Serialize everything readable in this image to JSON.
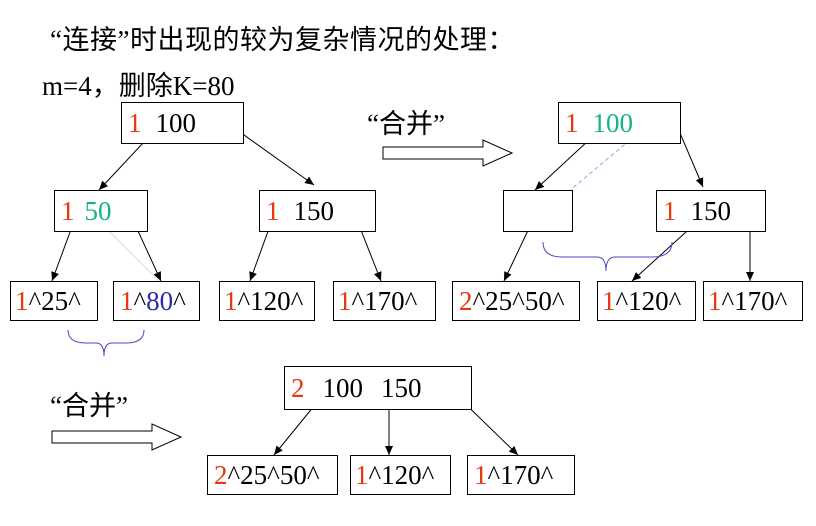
{
  "heading": "“连接”时出现的较为复杂情况的处理：",
  "condition": "m=4，删除K=80",
  "merge_label": "“合并”",
  "colors": {
    "count": "#e8380d",
    "highlight_key": "#15b38a",
    "deleted_key": "#2a2ab0",
    "brace": "#4a4ac0"
  },
  "tree1": {
    "root": {
      "count": "1",
      "key": "100"
    },
    "left": {
      "count": "1",
      "key": "50"
    },
    "right": {
      "count": "1",
      "key": "150"
    },
    "leaf1": {
      "count": "1",
      "rest": "^25^"
    },
    "leaf2": {
      "count": "1",
      "caret": "^",
      "key": "80",
      "tail": "^"
    },
    "leaf3": {
      "count": "1",
      "rest": "^120^"
    },
    "leaf4": {
      "count": "1",
      "rest": "^170^"
    }
  },
  "tree2": {
    "root": {
      "count": "1",
      "key": "100"
    },
    "right": {
      "count": "1",
      "key": "150"
    },
    "leaf1": {
      "count": "2",
      "rest": "^25^50^"
    },
    "leaf2": {
      "count": "1",
      "rest": "^120^"
    },
    "leaf3": {
      "count": "1",
      "rest": "^170^"
    }
  },
  "tree3": {
    "root": {
      "count": "2",
      "key1": "100",
      "key2": "150"
    },
    "leaf1": {
      "count": "2",
      "rest": "^25^50^"
    },
    "leaf2": {
      "count": "1",
      "rest": "^120^"
    },
    "leaf3": {
      "count": "1",
      "rest": "^170^"
    }
  }
}
